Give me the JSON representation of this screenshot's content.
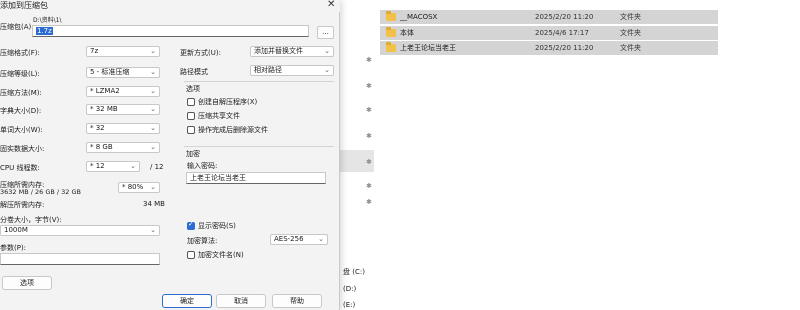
{
  "dialog": {
    "title": "添加到压缩包",
    "archive_label": "压缩包(A)",
    "archive_folder": "D:\\资料\\1\\",
    "archive_name": "1.7z",
    "browse_label": "...",
    "format_label": "压缩格式(F):",
    "format_value": "7z",
    "level_label": "压缩等级(L):",
    "level_value": "5 - 标准压缩",
    "method_label": "压缩方法(M):",
    "method_value": "* LZMA2",
    "dict_label": "字典大小(D):",
    "dict_value": "* 32 MB",
    "word_label": "单词大小(W):",
    "word_value": "* 32",
    "solid_label": "固实数据大小:",
    "solid_value": "* 8 GB",
    "cpu_label": "CPU 线程数:",
    "cpu_value": "* 12",
    "cpu_total": "/ 12",
    "mem_comp_label": "压缩所需内存:",
    "mem_comp_value": "3632 MB / 26 GB / 32 GB",
    "mem_percent": "* 80%",
    "mem_decomp_label": "解压所需内存:",
    "mem_decomp_value": "34 MB",
    "split_label": "分卷大小，字节(V):",
    "split_value": "1000M",
    "params_label": "参数(P):",
    "params_value": "",
    "options_button": "选项",
    "update_label": "更新方式(U):",
    "update_value": "添加并替换文件",
    "pathmode_label": "路径模式",
    "pathmode_value": "相对路径",
    "options_group": "选项",
    "opt_sfx": "创建自解压程序(X)",
    "opt_shared": "压缩共享文件",
    "opt_delete": "操作完成后删除源文件",
    "encrypt_group": "加密",
    "password_label": "输入密码:",
    "password_value": "上老王论坛当老王",
    "show_password": "显示密码(S)",
    "encrypt_method_label": "加密算法:",
    "encrypt_method_value": "AES-256",
    "encrypt_names": "加密文件名(N)",
    "ok": "确定",
    "cancel": "取消",
    "help": "帮助"
  },
  "explorer": {
    "files": [
      {
        "name": "__MACOSX",
        "date": "2025/2/20 11:20",
        "type": "文件夹"
      },
      {
        "name": "本体",
        "date": "2025/4/6 17:17",
        "type": "文件夹"
      },
      {
        "name": "上老王论坛当老王",
        "date": "2025/2/20 11:20",
        "type": "文件夹"
      }
    ],
    "drive_c": "盘 (C:)",
    "drive_d": "(D:)",
    "drive_e": "(E:)",
    "pin_glyph": "✱"
  }
}
